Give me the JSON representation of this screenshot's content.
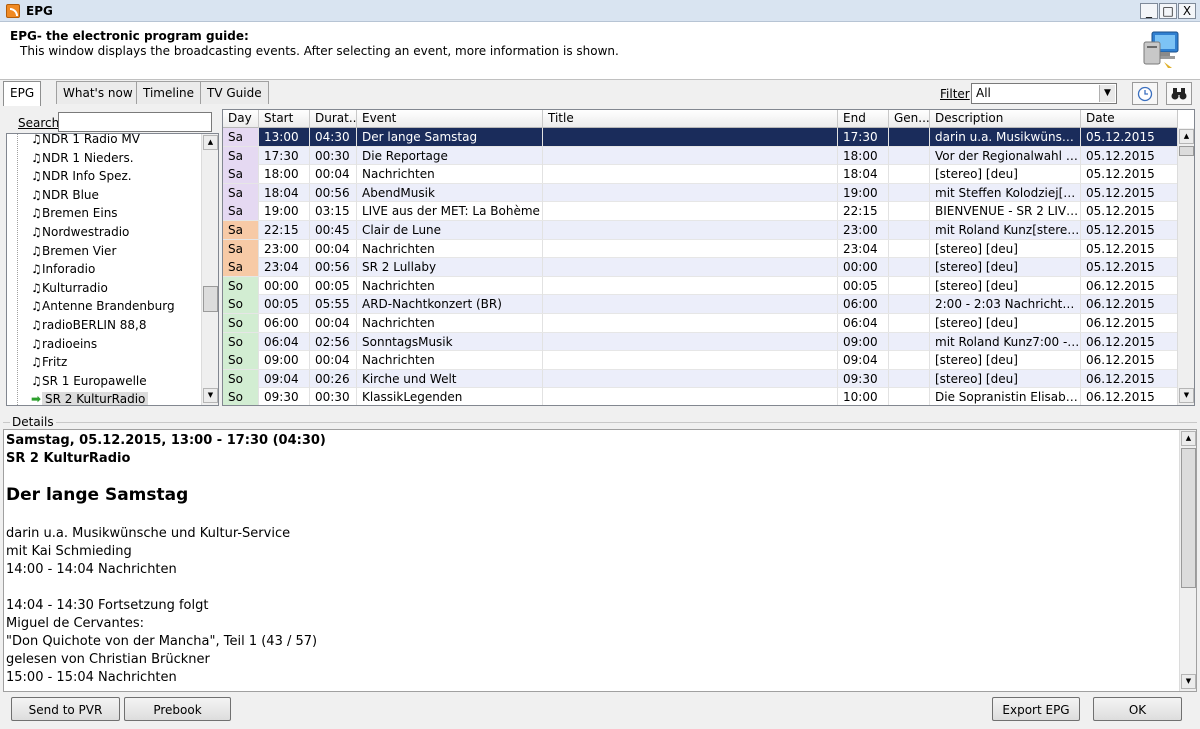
{
  "window": {
    "title": "EPG",
    "minimize": "_",
    "maximize": "□",
    "close": "X"
  },
  "header": {
    "title": "EPG- the electronic program guide:",
    "description": "This window displays the broadcasting events. After selecting an event, more information is shown."
  },
  "tabs": [
    "EPG",
    "What's now",
    "Timeline",
    "TV Guide"
  ],
  "filter": {
    "label": "Filter",
    "value": "All"
  },
  "search": {
    "label": "Search",
    "value": ""
  },
  "stations": [
    "NDR 1 Radio MV",
    "NDR 1 Nieders.",
    "NDR Info Spez.",
    "NDR Blue",
    "Bremen Eins",
    "Nordwestradio",
    "Bremen Vier",
    "Inforadio",
    "Kulturradio",
    "Antenne Brandenburg",
    "radioBERLIN 88,8",
    "radioeins",
    "Fritz",
    "SR 1 Europawelle",
    "SR 2 KulturRadio"
  ],
  "grid": {
    "columns": [
      "Day",
      "Start",
      "Durat...",
      "Event",
      "Title",
      "End",
      "Gen...",
      "Description",
      "Date"
    ],
    "rows": [
      [
        "Sa",
        "13:00",
        "04:30",
        "Der lange Samstag",
        "",
        "17:30",
        "",
        "darin u.a. Musikwünsche ...",
        "05.12.2015"
      ],
      [
        "Sa",
        "17:30",
        "00:30",
        "Die Reportage",
        "",
        "18:00",
        "",
        "Vor der Regionalwahl in ...",
        "05.12.2015"
      ],
      [
        "Sa",
        "18:00",
        "00:04",
        "Nachrichten",
        "",
        "18:04",
        "",
        "[stereo] [deu]",
        "05.12.2015"
      ],
      [
        "Sa",
        "18:04",
        "00:56",
        "AbendMusik",
        "",
        "19:00",
        "",
        "mit Steffen Kolodziej[st...",
        "05.12.2015"
      ],
      [
        "Sa",
        "19:00",
        "03:15",
        "LIVE aus der MET: La Bohème",
        "",
        "22:15",
        "",
        "BIENVENUE - SR 2 LIVE ...",
        "05.12.2015"
      ],
      [
        "Sa",
        "22:15",
        "00:45",
        "Clair de Lune",
        "",
        "23:00",
        "",
        "mit Roland Kunz[stereo...",
        "05.12.2015"
      ],
      [
        "Sa",
        "23:00",
        "00:04",
        "Nachrichten",
        "",
        "23:04",
        "",
        "[stereo] [deu]",
        "05.12.2015"
      ],
      [
        "Sa",
        "23:04",
        "00:56",
        "SR 2 Lullaby",
        "",
        "00:00",
        "",
        "[stereo] [deu]",
        "05.12.2015"
      ],
      [
        "So",
        "00:00",
        "00:05",
        "Nachrichten",
        "",
        "00:05",
        "",
        "[stereo] [deu]",
        "06.12.2015"
      ],
      [
        "So",
        "00:05",
        "05:55",
        "ARD-Nachtkonzert (BR)",
        "",
        "06:00",
        "",
        "2:00 - 2:03 Nachrichten...",
        "06.12.2015"
      ],
      [
        "So",
        "06:00",
        "00:04",
        "Nachrichten",
        "",
        "06:04",
        "",
        "[stereo] [deu]",
        "06.12.2015"
      ],
      [
        "So",
        "06:04",
        "02:56",
        "SonntagsMusik",
        "",
        "09:00",
        "",
        "mit Roland Kunz7:00 - 7...",
        "06.12.2015"
      ],
      [
        "So",
        "09:00",
        "00:04",
        "Nachrichten",
        "",
        "09:04",
        "",
        "[stereo] [deu]",
        "06.12.2015"
      ],
      [
        "So",
        "09:04",
        "00:26",
        "Kirche und Welt",
        "",
        "09:30",
        "",
        "[stereo] [deu]",
        "06.12.2015"
      ],
      [
        "So",
        "09:30",
        "00:30",
        "KlassikLegenden",
        "",
        "10:00",
        "",
        "Die Sopranistin Elisabeth...",
        "06.12.2015"
      ]
    ]
  },
  "details": {
    "label": "Details",
    "datetime": "Samstag, 05.12.2015, 13:00 - 17:30  (04:30)",
    "station": "SR 2 KulturRadio",
    "event": "Der lange Samstag",
    "lines": [
      "darin u.a. Musikwünsche und Kultur-Service",
      "mit Kai Schmieding",
      "14:00 - 14:04 Nachrichten",
      "",
      "14:04 - 14:30 Fortsetzung folgt",
      "Miguel de Cervantes:",
      "\"Don Quichote von der Mancha\", Teil 1 (43 / 57)",
      "gelesen von Christian Brückner",
      "15:00 - 15:04 Nachrichten"
    ]
  },
  "buttons": {
    "send_to_pvr": "Send to PVR",
    "prebook": "Prebook",
    "export_epg": "Export EPG",
    "ok": "OK"
  }
}
